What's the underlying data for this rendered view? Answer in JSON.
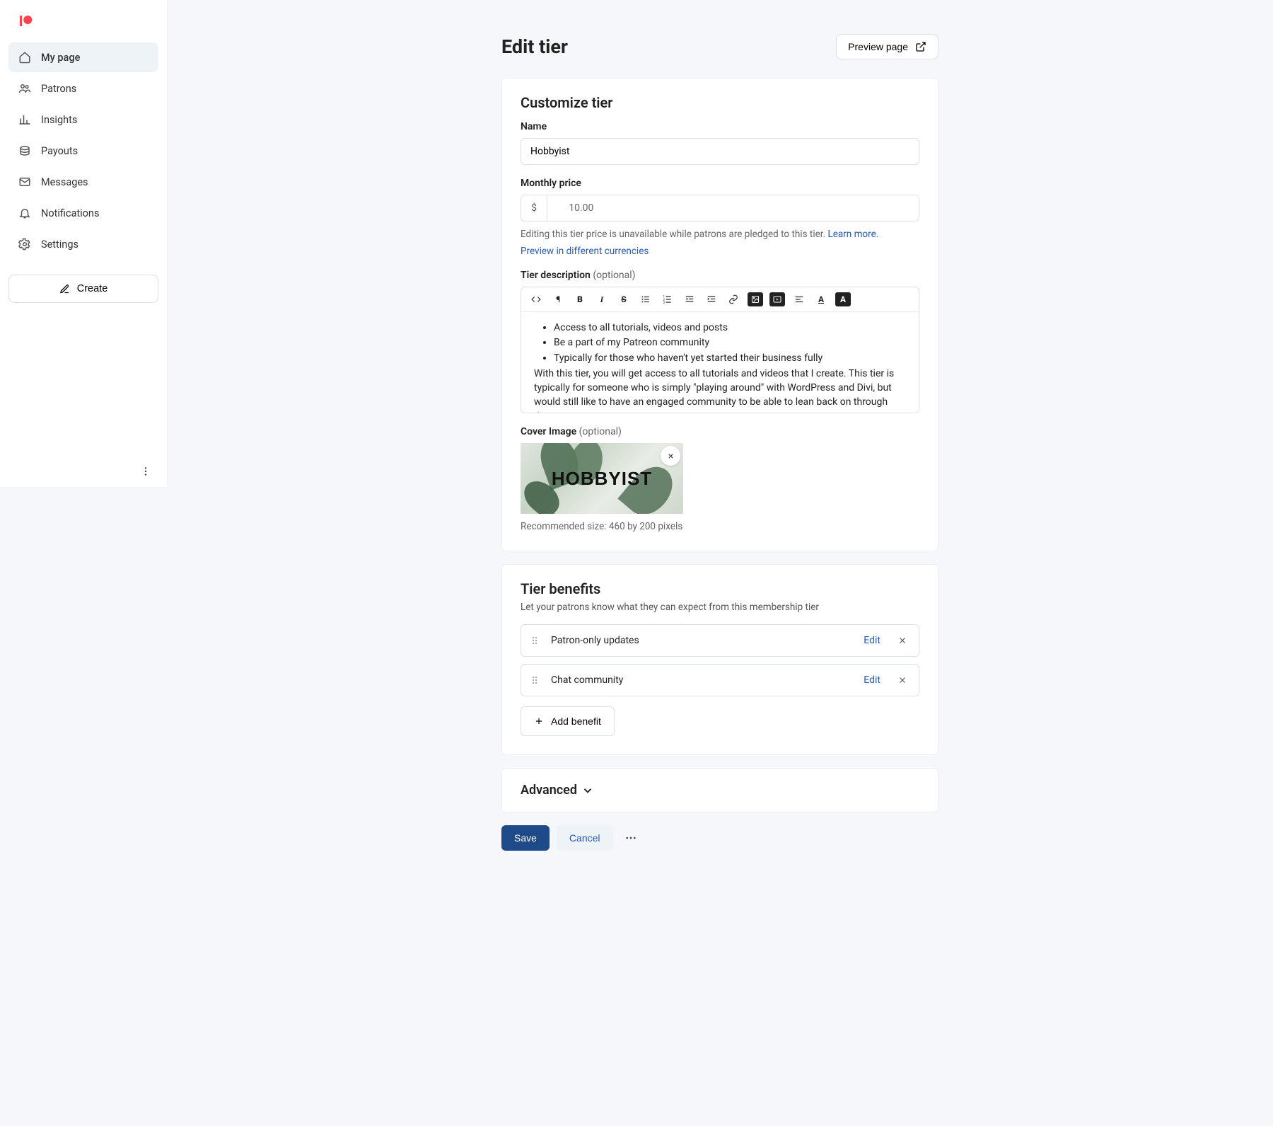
{
  "sidebar": {
    "items": [
      {
        "label": "My page",
        "active": true
      },
      {
        "label": "Patrons",
        "active": false
      },
      {
        "label": "Insights",
        "active": false
      },
      {
        "label": "Payouts",
        "active": false
      },
      {
        "label": "Messages",
        "active": false
      },
      {
        "label": "Notifications",
        "active": false
      },
      {
        "label": "Settings",
        "active": false
      }
    ],
    "create_label": "Create"
  },
  "page": {
    "title": "Edit tier",
    "preview_label": "Preview page"
  },
  "customize": {
    "heading": "Customize tier",
    "name_label": "Name",
    "name_value": "Hobbyist",
    "price_label": "Monthly price",
    "price_currency": "$",
    "price_value": "10.00",
    "price_help_pre": "Editing this tier price is unavailable while patrons are pledged to this tier. ",
    "price_help_link": "Learn more.",
    "preview_currencies": "Preview in different currencies",
    "desc_label": "Tier description",
    "desc_optional": " (optional)",
    "desc_bullets": [
      "Access to all tutorials, videos and posts",
      "Be a part of my Patreon community",
      "Typically for those who haven't yet started their business fully"
    ],
    "desc_para": "With this tier, you will get access to all tutorials and videos that I create. This tier is typically for someone who is simply \"playing around\" with WordPress and Divi, but would still like to have an engaged community to be able to lean back on through their journey.",
    "cover_label": "Cover Image",
    "cover_optional": " (optional)",
    "cover_text": "HOBBYIST",
    "cover_hint": "Recommended size: 460 by 200 pixels"
  },
  "benefits": {
    "heading": "Tier benefits",
    "subtitle": "Let your patrons know what they can expect from this membership tier",
    "items": [
      {
        "label": "Patron-only updates"
      },
      {
        "label": "Chat community"
      }
    ],
    "edit_label": "Edit",
    "add_label": "Add benefit"
  },
  "advanced": {
    "heading": "Advanced"
  },
  "actions": {
    "save": "Save",
    "cancel": "Cancel"
  }
}
